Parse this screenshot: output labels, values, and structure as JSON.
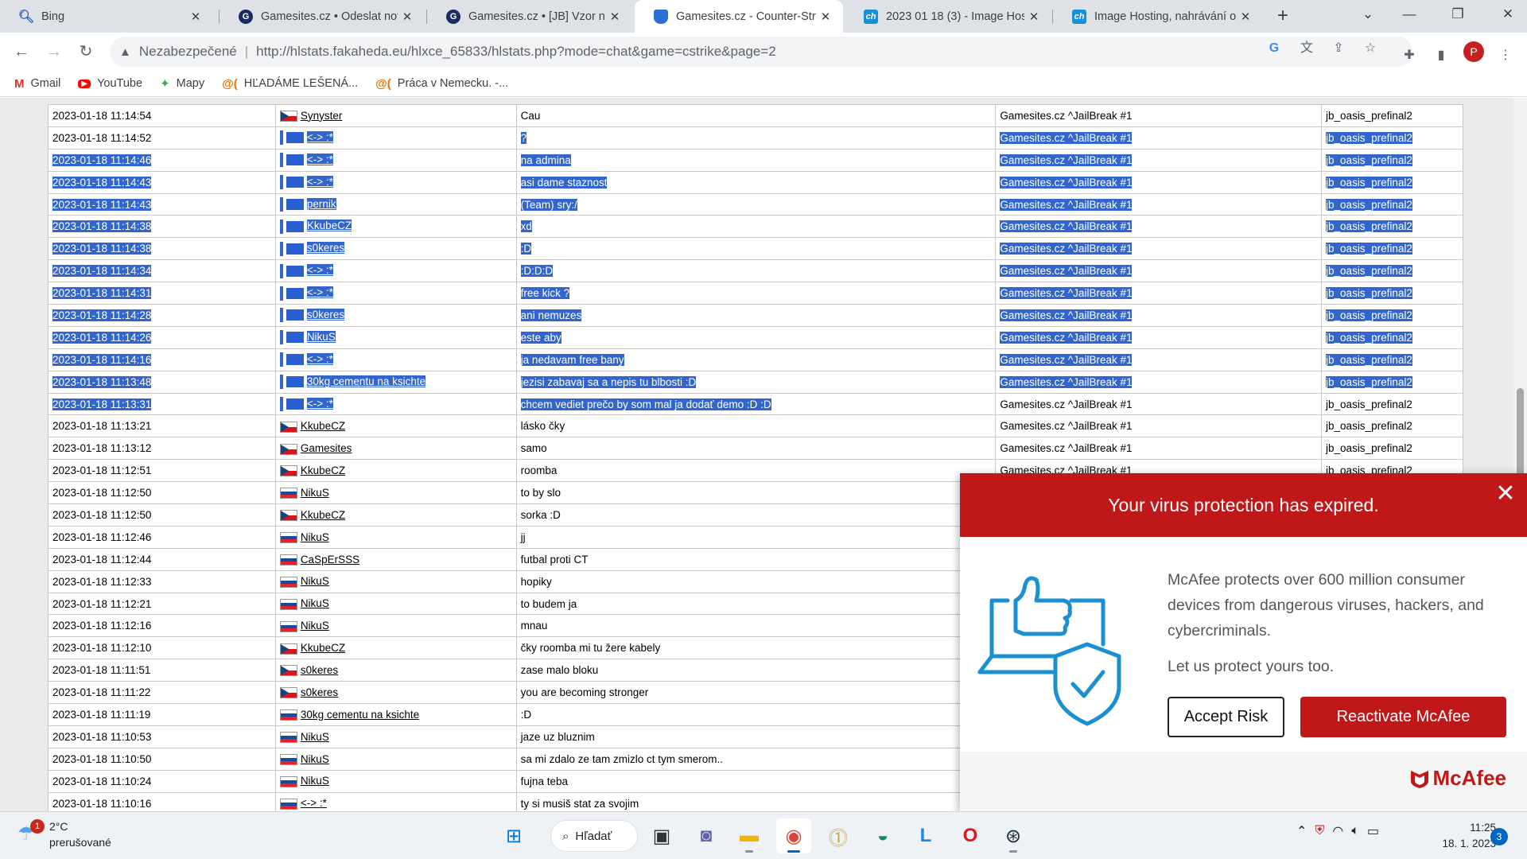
{
  "tabs": [
    {
      "title": "Bing",
      "icon": "bing-icon"
    },
    {
      "title": "Gamesites.cz • Odeslat nov",
      "icon": "gamesites-icon"
    },
    {
      "title": "Gamesites.cz • [JB] Vzor na",
      "icon": "gamesites-icon"
    },
    {
      "title": "Gamesites.cz - Counter-Stri",
      "icon": "counter-strike-icon",
      "active": true
    },
    {
      "title": "2023 01 18 (3) - Image Hos",
      "icon": "ch-icon"
    },
    {
      "title": "Image Hosting, nahrávání o",
      "icon": "ch-icon"
    }
  ],
  "toolbar": {
    "security_label": "Nezabezpečené",
    "url": "http://hlstats.fakaheda.eu/hlxce_65833/hlstats.php?mode=chat&game=cstrike&page=2",
    "profile_initial": "P"
  },
  "bookmarks": [
    {
      "label": "Gmail",
      "icon": "gmail-icon"
    },
    {
      "label": "YouTube",
      "icon": "youtube-icon"
    },
    {
      "label": "Mapy",
      "icon": "maps-icon"
    },
    {
      "label": "HĽADÁME LEŠENÁ...",
      "icon": "at-icon"
    },
    {
      "label": "Práca v Nemecku. -...",
      "icon": "at-icon"
    }
  ],
  "chat_rows": [
    {
      "time": "2023-01-18 11:14:54",
      "name": "Synyster",
      "flag": "cz",
      "msg": "Cau",
      "server": "Gamesites.cz ^JailBreak #1",
      "map": "jb_oasis_prefinal2",
      "hl": ""
    },
    {
      "time": "2023-01-18 11:14:52",
      "name": "<-> :*",
      "flag": "hl",
      "msg": "?",
      "server": "Gamesites.cz ^JailBreak #1",
      "map": "jb_oasis_prefinal2",
      "hl": "partial"
    },
    {
      "time": "2023-01-18 11:14:46",
      "name": "<-> :*",
      "flag": "hl",
      "msg": "na admina",
      "server": "Gamesites.cz ^JailBreak #1",
      "map": "jb_oasis_prefinal2",
      "hl": "full"
    },
    {
      "time": "2023-01-18 11:14:43",
      "name": "<-> :*",
      "flag": "hl",
      "msg": "asi dame staznost",
      "server": "Gamesites.cz ^JailBreak #1",
      "map": "jb_oasis_prefinal2",
      "hl": "full"
    },
    {
      "time": "2023-01-18 11:14:43",
      "name": "pernik",
      "flag": "hl",
      "msg": "(Team) sry:/",
      "server": "Gamesites.cz ^JailBreak #1",
      "map": "jb_oasis_prefinal2",
      "hl": "full"
    },
    {
      "time": "2023-01-18 11:14:38",
      "name": "KkubeCZ",
      "flag": "hl",
      "msg": "xd",
      "server": "Gamesites.cz ^JailBreak #1",
      "map": "jb_oasis_prefinal2",
      "hl": "full"
    },
    {
      "time": "2023-01-18 11:14:38",
      "name": "s0keres",
      "flag": "hl",
      "msg": ":D",
      "server": "Gamesites.cz ^JailBreak #1",
      "map": "jb_oasis_prefinal2",
      "hl": "full"
    },
    {
      "time": "2023-01-18 11:14:34",
      "name": "<-> :*",
      "flag": "hl",
      "msg": ":D:D:D",
      "server": "Gamesites.cz ^JailBreak #1",
      "map": "jb_oasis_prefinal2",
      "hl": "full"
    },
    {
      "time": "2023-01-18 11:14:31",
      "name": "<-> :*",
      "flag": "hl",
      "msg": "free kick ?",
      "server": "Gamesites.cz ^JailBreak #1",
      "map": "jb_oasis_prefinal2",
      "hl": "full"
    },
    {
      "time": "2023-01-18 11:14:28",
      "name": "s0keres",
      "flag": "hl",
      "msg": "ani nemuzes",
      "server": "Gamesites.cz ^JailBreak #1",
      "map": "jb_oasis_prefinal2",
      "hl": "full"
    },
    {
      "time": "2023-01-18 11:14:26",
      "name": "NikuS",
      "flag": "hl",
      "msg": "este aby",
      "server": "Gamesites.cz ^JailBreak #1",
      "map": "jb_oasis_prefinal2",
      "hl": "full"
    },
    {
      "time": "2023-01-18 11:14:16",
      "name": "<-> :*",
      "flag": "hl",
      "msg": "ja nedavam free bany",
      "server": "Gamesites.cz ^JailBreak #1",
      "map": "jb_oasis_prefinal2",
      "hl": "full"
    },
    {
      "time": "2023-01-18 11:13:48",
      "name": "30kg cementu na ksichte",
      "flag": "hl",
      "msg": "jezisi zabavaj sa a nepis tu blbosti :D",
      "server": "Gamesites.cz ^JailBreak #1",
      "map": "jb_oasis_prefinal2",
      "hl": "full"
    },
    {
      "time": "2023-01-18 11:13:31",
      "name": "<-> :*",
      "flag": "hl",
      "msg": "chcem vediet prečo by som mal ja dodať demo :D :D",
      "server": "Gamesites.cz ^JailBreak #1",
      "map": "jb_oasis_prefinal2",
      "hl": "end"
    },
    {
      "time": "2023-01-18 11:13:21",
      "name": "KkubeCZ",
      "flag": "cz",
      "msg": "lásko čky",
      "server": "Gamesites.cz ^JailBreak #1",
      "map": "jb_oasis_prefinal2",
      "hl": ""
    },
    {
      "time": "2023-01-18 11:13:12",
      "name": "Gamesites",
      "flag": "cz",
      "msg": "samo",
      "server": "Gamesites.cz ^JailBreak #1",
      "map": "jb_oasis_prefinal2",
      "hl": ""
    },
    {
      "time": "2023-01-18 11:12:51",
      "name": "KkubeCZ",
      "flag": "cz",
      "msg": "roomba",
      "server": "Gamesites.cz ^JailBreak #1",
      "map": "jb_oasis_prefinal2",
      "hl": ""
    },
    {
      "time": "2023-01-18 11:12:50",
      "name": "NikuS",
      "flag": "sk",
      "msg": "to by slo",
      "server": "",
      "map": "",
      "hl": ""
    },
    {
      "time": "2023-01-18 11:12:50",
      "name": "KkubeCZ",
      "flag": "cz",
      "msg": "sorka :D",
      "server": "",
      "map": "",
      "hl": ""
    },
    {
      "time": "2023-01-18 11:12:46",
      "name": "NikuS",
      "flag": "sk",
      "msg": "jj",
      "server": "",
      "map": "",
      "hl": ""
    },
    {
      "time": "2023-01-18 11:12:44",
      "name": "CaSpErSSS",
      "flag": "sk",
      "msg": "futbal proti CT",
      "server": "",
      "map": "",
      "hl": ""
    },
    {
      "time": "2023-01-18 11:12:33",
      "name": "NikuS",
      "flag": "sk",
      "msg": "hopiky",
      "server": "",
      "map": "",
      "hl": ""
    },
    {
      "time": "2023-01-18 11:12:21",
      "name": "NikuS",
      "flag": "sk",
      "msg": "to budem ja",
      "server": "",
      "map": "",
      "hl": ""
    },
    {
      "time": "2023-01-18 11:12:16",
      "name": "NikuS",
      "flag": "sk",
      "msg": "mnau",
      "server": "",
      "map": "",
      "hl": ""
    },
    {
      "time": "2023-01-18 11:12:10",
      "name": "KkubeCZ",
      "flag": "cz",
      "msg": "čky roomba mi tu žere kabely",
      "server": "",
      "map": "",
      "hl": ""
    },
    {
      "time": "2023-01-18 11:11:51",
      "name": "s0keres",
      "flag": "cz",
      "msg": "zase malo bloku",
      "server": "",
      "map": "",
      "hl": ""
    },
    {
      "time": "2023-01-18 11:11:22",
      "name": "s0keres",
      "flag": "cz",
      "msg": "you are becoming stronger",
      "server": "",
      "map": "",
      "hl": ""
    },
    {
      "time": "2023-01-18 11:11:19",
      "name": "30kg cementu na ksichte",
      "flag": "sk",
      "msg": ":D",
      "server": "",
      "map": "",
      "hl": ""
    },
    {
      "time": "2023-01-18 11:10:53",
      "name": "NikuS",
      "flag": "sk",
      "msg": "jaze uz bluznim",
      "server": "",
      "map": "",
      "hl": ""
    },
    {
      "time": "2023-01-18 11:10:50",
      "name": "NikuS",
      "flag": "sk",
      "msg": "sa mi zdalo ze tam zmizlo ct tym smerom..",
      "server": "",
      "map": "",
      "hl": ""
    },
    {
      "time": "2023-01-18 11:10:24",
      "name": "NikuS",
      "flag": "sk",
      "msg": "fujna teba",
      "server": "",
      "map": "",
      "hl": ""
    },
    {
      "time": "2023-01-18 11:10:16",
      "name": "<-> :*",
      "flag": "sk",
      "msg": "ty si musiš stat za svojim",
      "server": "",
      "map": "",
      "hl": ""
    }
  ],
  "mcafee": {
    "title": "Your virus protection has expired.",
    "body": "McAfee protects over 600 million consumer devices from dangerous viruses, hackers, and cybercriminals.",
    "body2": "Let us protect yours too.",
    "accept_label": "Accept Risk",
    "reactivate_label": "Reactivate McAfee",
    "logo_text": "McAfee",
    "brand_color": "#c01818"
  },
  "taskbar": {
    "weather_temp": "2°C",
    "weather_desc": "prerušované",
    "weather_badge": "1",
    "search_label": "Hľadať",
    "time": "11:25",
    "date": "18. 1. 2023",
    "notif_count": "3"
  }
}
